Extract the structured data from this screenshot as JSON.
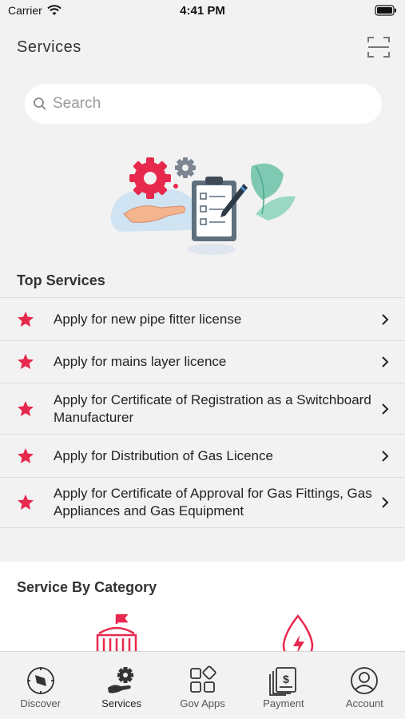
{
  "status_bar": {
    "carrier": "Carrier",
    "time": "4:41 PM"
  },
  "header": {
    "title": "Services"
  },
  "search": {
    "placeholder": "Search"
  },
  "top_services": {
    "title": "Top Services",
    "items": [
      {
        "label": "Apply for new pipe fitter license"
      },
      {
        "label": "Apply for mains layer licence"
      },
      {
        "label": "Apply for Certificate of Registration as a Switchboard Manufacturer"
      },
      {
        "label": "Apply for Distribution of Gas Licence"
      },
      {
        "label": "Apply for Certificate of Approval for Gas Fittings, Gas Appliances and Gas Equipment"
      }
    ]
  },
  "category": {
    "title": "Service By Category"
  },
  "tabs": [
    {
      "label": "Discover",
      "icon": "compass-icon"
    },
    {
      "label": "Services",
      "icon": "hand-gear-icon",
      "active": true
    },
    {
      "label": "Gov Apps",
      "icon": "apps-grid-icon"
    },
    {
      "label": "Payment",
      "icon": "bill-icon"
    },
    {
      "label": "Account",
      "icon": "user-icon"
    }
  ],
  "colors": {
    "accent": "#e8294e",
    "background": "#f2f2f2",
    "text": "#222222"
  }
}
